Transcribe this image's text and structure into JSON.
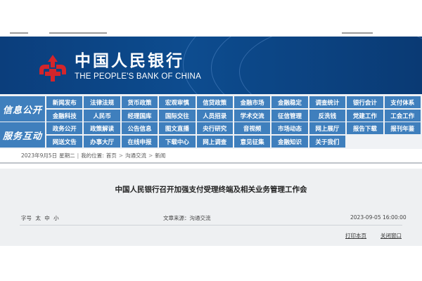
{
  "colors": {
    "banner": "#0d4c8f",
    "nav_blue": "#3f7fbd",
    "logo_red": "#d4252b",
    "article_bg": "#eef0f2"
  },
  "header": {
    "brand_cn": "中国人民银行",
    "brand_en": "THE PEOPLE'S BANK OF CHINA",
    "logo_icon": "pboc-emblem-icon"
  },
  "nav": {
    "sections": [
      {
        "label": "信息公开",
        "items": [
          "新闻发布",
          "法律法规",
          "货币政策",
          "宏观审慎",
          "信贷政策",
          "金融市场",
          "金融稳定",
          "调查统计",
          "银行会计",
          "支付体系",
          "金融科技",
          "人民币",
          "经理国库",
          "国际交往",
          "人员招录",
          "学术交流",
          "征信管理",
          "反洗钱",
          "党建工作",
          "工会工作"
        ]
      },
      {
        "label": "服务互动",
        "items": [
          "政务公开",
          "政策解读",
          "公告信息",
          "图文直播",
          "央行研究",
          "音视频",
          "市场动态",
          "网上展厅",
          "报告下载",
          "报刊年鉴",
          "网送文告",
          "办事大厅",
          "在线申报",
          "下载中心",
          "网上调查",
          "意见征集",
          "金融知识",
          "关于我们"
        ]
      }
    ]
  },
  "breadcrumb": {
    "date": "2023年9月5日",
    "weekday": "星期二",
    "prefix": "我的位置:",
    "items": [
      "首页",
      "沟通交流",
      "新闻"
    ],
    "separator": ">"
  },
  "article": {
    "title": "中国人民银行召开加强支付受理终端及相关业务管理工作会",
    "font_size_label": "字号",
    "font_sizes": [
      "太",
      "中",
      "小"
    ],
    "source": "文章来源：沟通交流",
    "date": "2023-09-05 16:00:00",
    "print_label": "打印本页",
    "close_label": "关闭窗口"
  }
}
